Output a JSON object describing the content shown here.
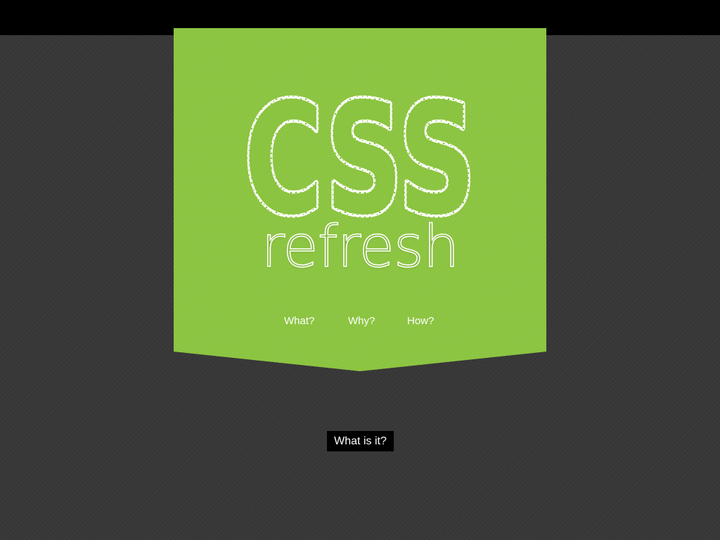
{
  "colors": {
    "banner_green": "#8bc440",
    "background_dark": "#383838",
    "top_bar": "#000000",
    "text_white": "#ffffff"
  },
  "logo": {
    "main_text": "CSS",
    "sub_text": "refresh"
  },
  "nav": {
    "items": [
      {
        "label": "What?"
      },
      {
        "label": "Why?"
      },
      {
        "label": "How?"
      }
    ]
  },
  "section": {
    "button_label": "What is it?"
  }
}
